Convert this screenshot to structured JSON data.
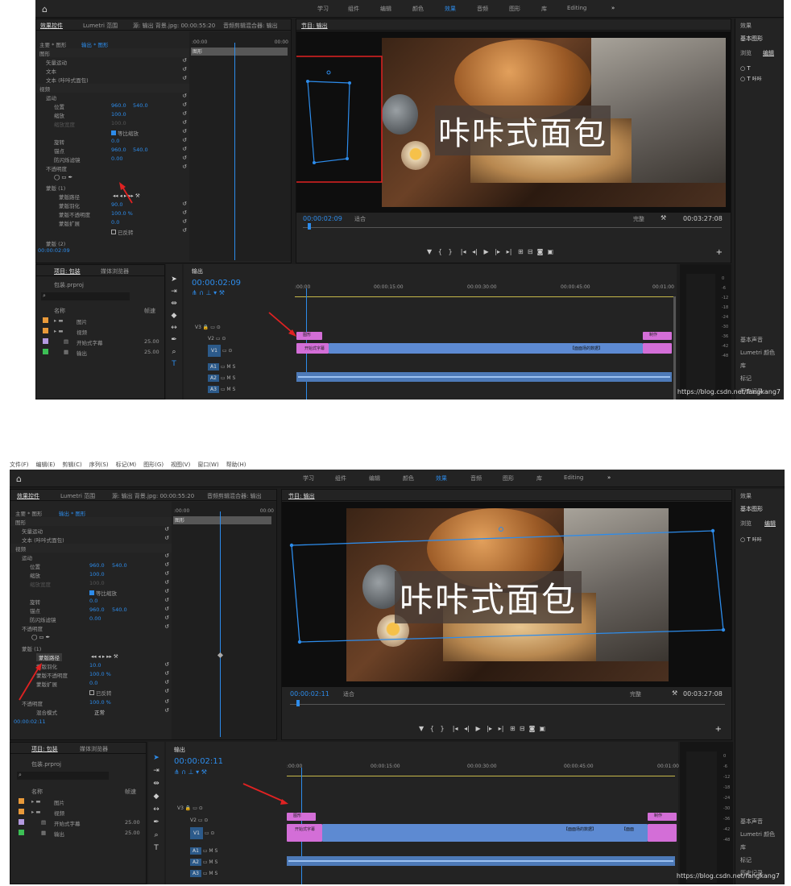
{
  "menubar": [
    "文件(F)",
    "编辑(E)",
    "剪辑(C)",
    "序列(S)",
    "标记(M)",
    "图形(G)",
    "视图(V)",
    "窗口(W)",
    "帮助(H)"
  ],
  "workspace_tabs": [
    "学习",
    "组件",
    "编辑",
    "颜色",
    "效果",
    "音频",
    "图形",
    "库",
    "Editing"
  ],
  "workspace_active": "效果",
  "more": "»",
  "panel_tabs": {
    "effect_controls": "效果控件",
    "lumetri": "Lumetri 范围",
    "source": "源: 输出 背景.jpg: 00:00:55:20",
    "audio_mixer": "音频剪辑混合器: 输出",
    "program": "节目: 输出"
  },
  "ec": {
    "master": "主要 * 图形",
    "seq": "输出 * 图形",
    "graphic_section": "图形",
    "vector_motion": "矢量运动",
    "text1": "文本",
    "text2": "文本 (咔咔式面包)",
    "video_section": "视频",
    "motion": "运动",
    "position": "位置",
    "pos_x": "960.0",
    "pos_y": "540.0",
    "scale": "缩放",
    "scale_val": "100.0",
    "scale_width": "缩放宽度",
    "scale_width_val": "100.0",
    "uniform": "等比缩放",
    "rotation": "旋转",
    "rotation_val": "0.0",
    "anchor": "锚点",
    "anchor_x": "960.0",
    "anchor_y": "540.0",
    "antiflicker": "防闪烁滤镜",
    "antiflicker_val": "0.00",
    "opacity_section": "不透明度",
    "mask1": "蒙版 (1)",
    "mask_path": "蒙版路径",
    "mask_feather": "蒙版羽化",
    "mask_opacity": "蒙版不透明度",
    "mask_expand": "蒙版扩展",
    "inverted": "已反转",
    "mask2": "蒙版 (2)",
    "opacity": "不透明度",
    "opacity_val": "100.0 %",
    "blend": "混合模式",
    "blend_val": "正常",
    "s1": {
      "feather": "90.0",
      "mask_opacity": "100.0 %",
      "expand": "0.0",
      "timecode": "00:00:02:09"
    },
    "s2": {
      "feather": "10.0",
      "mask_opacity": "100.0 %",
      "expand": "0.0",
      "timecode": "00:00:02:11"
    },
    "clip_label": "图形",
    "time_start": ":00:00",
    "time_end": "00:00"
  },
  "program": {
    "overlay_text": "咔咔式面包",
    "fit": "适合",
    "quality": "完整",
    "duration": "00:03:27:08",
    "s1_timecode": "00:00:02:09",
    "s2_timecode": "00:00:02:11"
  },
  "project": {
    "tab": "项目: 包装",
    "browser": "媒体浏览器",
    "file": "包装.prproj",
    "col_name": "名称",
    "col_fps": "帧速",
    "items": [
      {
        "name": "图片",
        "fps": ""
      },
      {
        "name": "视频",
        "fps": ""
      },
      {
        "name": "开始式字幕",
        "fps": "25.00"
      },
      {
        "name": "输出",
        "fps": "25.00"
      }
    ]
  },
  "timeline": {
    "tab": "输出",
    "s1_tc": "00:00:02:09",
    "s2_tc": "00:00:02:11",
    "ruler": [
      ":00:00",
      "00:00:15:00",
      "00:00:30:00",
      "00:00:45:00",
      "00:01:00"
    ],
    "tracks_v": [
      "V3",
      "V2",
      "V1"
    ],
    "tracks_a": [
      "A1",
      "A2",
      "A3"
    ],
    "clip_graphic": "图形",
    "clip_text": "开始式字幕",
    "clip_fx": "制作",
    "clip_label1": "【面面场的数据】",
    "clip_label2": "【面面"
  },
  "meter_scale": [
    "0",
    "-6",
    "-12",
    "-18",
    "-24",
    "-30",
    "-36",
    "-42",
    "-48"
  ],
  "right": {
    "effects": "效果",
    "eg": "基本图形",
    "browse": "浏览",
    "edit": "编辑",
    "eaudio": "基本声音",
    "lumetri_color": "Lumetri 颜色",
    "lib": "库",
    "markers": "标记",
    "history": "历史记录",
    "text_item": "咔咔"
  },
  "watermark": "https://blog.csdn.net/fangkang7"
}
